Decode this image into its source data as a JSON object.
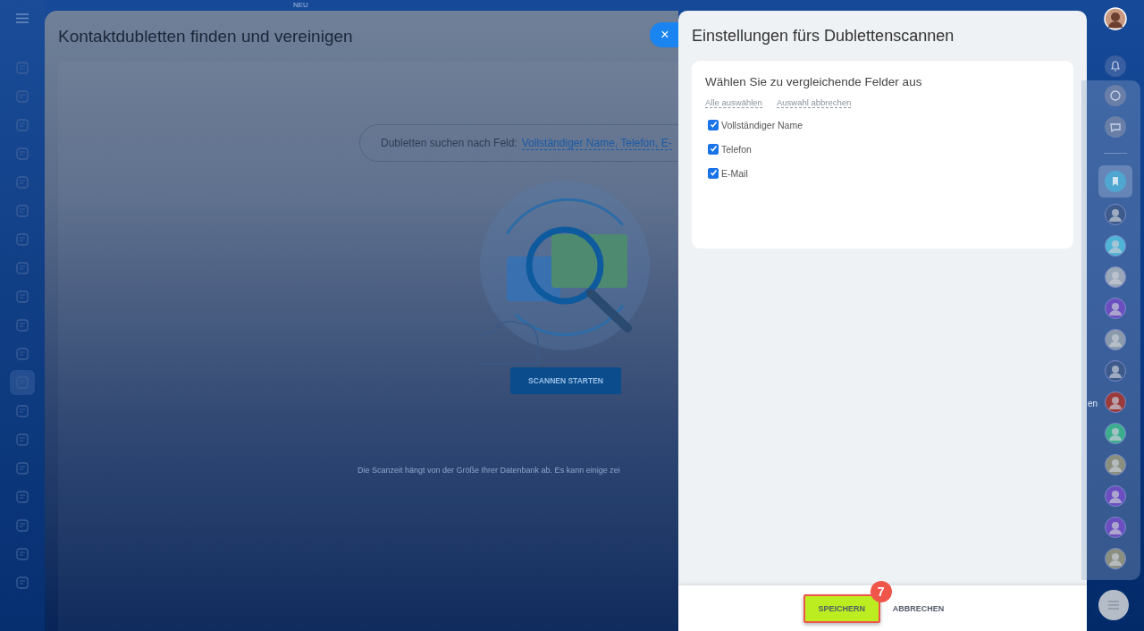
{
  "top_bar": {
    "new_badge": "NEU"
  },
  "background_slider": {
    "title": "Kontaktdubletten finden und vereinigen",
    "search_by": {
      "label": "Dubletten suchen nach Feld:",
      "fields_link": "Vollständiger Name, Telefon, E-"
    },
    "start_button": "SCANNEN STARTEN",
    "hint": "Die Scanzeit hängt von der Größe Ihrer Datenbank ab. Es kann einige zei"
  },
  "close_button": "×",
  "settings_slider": {
    "title": "Einstellungen fürs Dublettenscannen",
    "card_title": "Wählen Sie zu vergleichende Felder aus",
    "links": [
      "Alle auswählen",
      "Auswahl abbrechen"
    ],
    "fields": [
      {
        "label": "Vollständiger Name",
        "checked": true
      },
      {
        "label": "Telefon",
        "checked": true
      },
      {
        "label": "E-Mail",
        "checked": true
      }
    ],
    "buttons": [
      {
        "label": "SPEICHERN",
        "kind": "primary",
        "highlighted": true,
        "step_badge": "7"
      },
      {
        "label": "ABBRECHEN",
        "kind": "link",
        "highlighted": false
      }
    ]
  },
  "right_bar": {
    "cut_label": "en"
  }
}
